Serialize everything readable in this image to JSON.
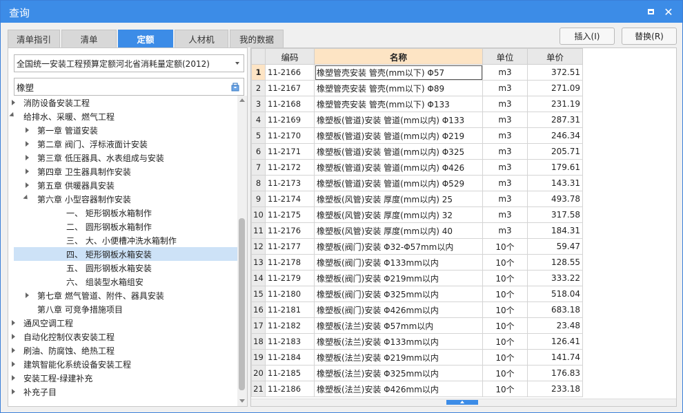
{
  "window": {
    "title": "查询"
  },
  "tabs": [
    "清单指引",
    "清单",
    "定额",
    "人材机",
    "我的数据"
  ],
  "active_tab": "定额",
  "buttons": {
    "insert": "插入(I)",
    "replace": "替换(R)"
  },
  "quota_library": "全国统一安装工程预算定额河北省消耗量定额(2012)",
  "search": {
    "value": "橡塑"
  },
  "tree": [
    {
      "label": "消防设备安装工程",
      "level": 0,
      "state": "collapsed"
    },
    {
      "label": "给排水、采暖、燃气工程",
      "level": 0,
      "state": "expanded"
    },
    {
      "label": "第一章 管道安装",
      "level": 1,
      "state": "collapsed"
    },
    {
      "label": "第二章 阀门、浮标液面计安装",
      "level": 1,
      "state": "collapsed"
    },
    {
      "label": "第三章 低压器具、水表组成与安装",
      "level": 1,
      "state": "collapsed"
    },
    {
      "label": "第四章 卫生器具制作安装",
      "level": 1,
      "state": "collapsed"
    },
    {
      "label": "第五章 供暖器具安装",
      "level": 1,
      "state": "collapsed"
    },
    {
      "label": "第六章 小型容器制作安装",
      "level": 1,
      "state": "expanded"
    },
    {
      "label": "一、 矩形钢板水箱制作",
      "level": 2,
      "state": "leaf"
    },
    {
      "label": "二、 圆形钢板水箱制作",
      "level": 2,
      "state": "leaf"
    },
    {
      "label": "三、 大、小便槽冲洗水箱制作",
      "level": 2,
      "state": "leaf"
    },
    {
      "label": "四、 矩形钢板水箱安装",
      "level": 2,
      "state": "leaf",
      "selected": true
    },
    {
      "label": "五、 圆形钢板水箱安装",
      "level": 2,
      "state": "leaf"
    },
    {
      "label": "六、 组装型水箱组安",
      "level": 2,
      "state": "leaf"
    },
    {
      "label": "第七章 燃气管道、附件、器具安装",
      "level": 1,
      "state": "collapsed"
    },
    {
      "label": "第八章 可竞争措施项目",
      "level": 1,
      "state": "leaf"
    },
    {
      "label": "通风空调工程",
      "level": 0,
      "state": "collapsed"
    },
    {
      "label": "自动化控制仪表安装工程",
      "level": 0,
      "state": "collapsed"
    },
    {
      "label": "刷油、防腐蚀、绝热工程",
      "level": 0,
      "state": "collapsed"
    },
    {
      "label": "建筑智能化系统设备安装工程",
      "level": 0,
      "state": "collapsed"
    },
    {
      "label": "安装工程-绿建补充",
      "level": 0,
      "state": "collapsed"
    },
    {
      "label": "补充子目",
      "level": 0,
      "state": "collapsed"
    }
  ],
  "table": {
    "headers": [
      "",
      "编码",
      "名称",
      "单位",
      "单价"
    ],
    "rows": [
      [
        "1",
        "11-2166",
        "橡塑管壳安装 管壳(mm以下) Φ57",
        "m3",
        "372.51"
      ],
      [
        "2",
        "11-2167",
        "橡塑管壳安装 管壳(mm以下) Φ89",
        "m3",
        "271.09"
      ],
      [
        "3",
        "11-2168",
        "橡塑管壳安装 管壳(mm以下) Φ133",
        "m3",
        "231.19"
      ],
      [
        "4",
        "11-2169",
        "橡塑板(管道)安装 管道(mm以内) Φ133",
        "m3",
        "287.31"
      ],
      [
        "5",
        "11-2170",
        "橡塑板(管道)安装 管道(mm以内) Φ219",
        "m3",
        "246.34"
      ],
      [
        "6",
        "11-2171",
        "橡塑板(管道)安装 管道(mm以内) Φ325",
        "m3",
        "205.71"
      ],
      [
        "7",
        "11-2172",
        "橡塑板(管道)安装 管道(mm以内) Φ426",
        "m3",
        "179.61"
      ],
      [
        "8",
        "11-2173",
        "橡塑板(管道)安装 管道(mm以内) Φ529",
        "m3",
        "143.31"
      ],
      [
        "9",
        "11-2174",
        "橡塑板(风管)安装 厚度(mm以内) 25",
        "m3",
        "493.78"
      ],
      [
        "10",
        "11-2175",
        "橡塑板(风管)安装 厚度(mm以内) 32",
        "m3",
        "317.58"
      ],
      [
        "11",
        "11-2176",
        "橡塑板(风管)安装 厚度(mm以内) 40",
        "m3",
        "184.31"
      ],
      [
        "12",
        "11-2177",
        "橡塑板(阀门)安装 Φ32-Φ57mm以内",
        "10个",
        "59.47"
      ],
      [
        "13",
        "11-2178",
        "橡塑板(阀门)安装 Φ133mm以内",
        "10个",
        "128.55"
      ],
      [
        "14",
        "11-2179",
        "橡塑板(阀门)安装 Φ219mm以内",
        "10个",
        "333.22"
      ],
      [
        "15",
        "11-2180",
        "橡塑板(阀门)安装 Φ325mm以内",
        "10个",
        "518.04"
      ],
      [
        "16",
        "11-2181",
        "橡塑板(阀门)安装 Φ426mm以内",
        "10个",
        "683.18"
      ],
      [
        "17",
        "11-2182",
        "橡塑板(法兰)安装 Φ57mm以内",
        "10个",
        "23.48"
      ],
      [
        "18",
        "11-2183",
        "橡塑板(法兰)安装 Φ133mm以内",
        "10个",
        "126.41"
      ],
      [
        "19",
        "11-2184",
        "橡塑板(法兰)安装 Φ219mm以内",
        "10个",
        "141.74"
      ],
      [
        "20",
        "11-2185",
        "橡塑板(法兰)安装 Φ325mm以内",
        "10个",
        "176.83"
      ],
      [
        "21",
        "11-2186",
        "橡塑板(法兰)安装 Φ426mm以内",
        "10个",
        "233.18"
      ]
    ]
  },
  "colors": {
    "accent": "#3c8ce7",
    "selected_row": "#cde2f7",
    "header_highlight": "#fde4c4"
  }
}
